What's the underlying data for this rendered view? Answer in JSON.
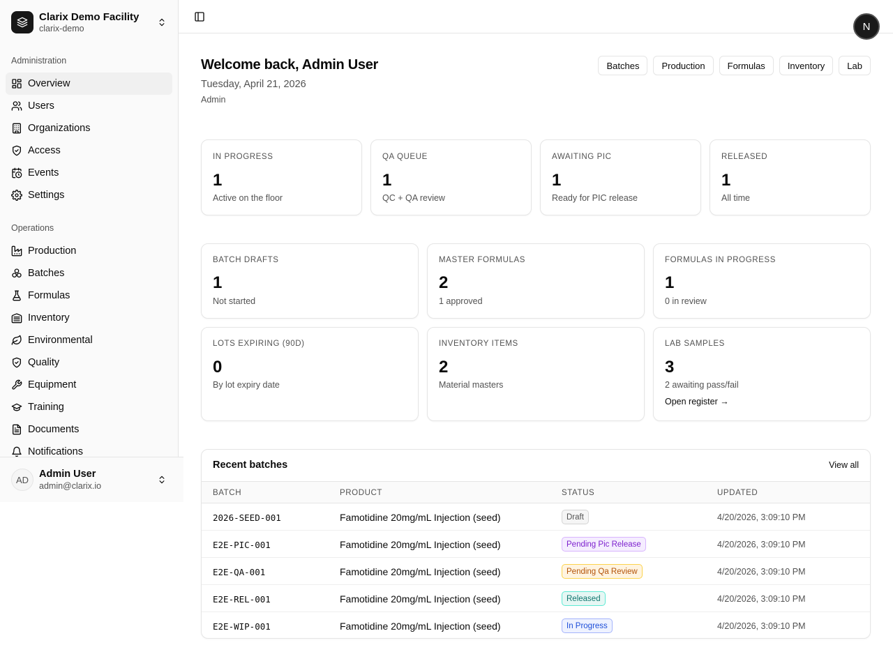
{
  "org": {
    "name": "Clarix Demo Facility",
    "slug": "clarix-demo"
  },
  "sidebar": {
    "groups": [
      {
        "label": "Administration",
        "items": [
          {
            "label": "Overview",
            "icon": "layout-dashboard-icon",
            "active": true
          },
          {
            "label": "Users",
            "icon": "users-icon"
          },
          {
            "label": "Organizations",
            "icon": "building-icon"
          },
          {
            "label": "Access",
            "icon": "shield-check-icon"
          },
          {
            "label": "Events",
            "icon": "calendar-clock-icon"
          },
          {
            "label": "Settings",
            "icon": "gear-icon"
          }
        ]
      },
      {
        "label": "Operations",
        "items": [
          {
            "label": "Production",
            "icon": "factory-icon"
          },
          {
            "label": "Batches",
            "icon": "boxes-icon"
          },
          {
            "label": "Formulas",
            "icon": "flask-icon"
          },
          {
            "label": "Inventory",
            "icon": "warehouse-icon"
          },
          {
            "label": "Environmental",
            "icon": "leaf-icon"
          },
          {
            "label": "Quality",
            "icon": "shield-icon"
          },
          {
            "label": "Equipment",
            "icon": "wrench-icon"
          },
          {
            "label": "Training",
            "icon": "graduation-cap-icon"
          },
          {
            "label": "Documents",
            "icon": "file-text-icon"
          },
          {
            "label": "Notifications",
            "icon": "bell-icon"
          }
        ]
      }
    ]
  },
  "user": {
    "initials": "AD",
    "name": "Admin User",
    "email": "admin@clarix.io"
  },
  "header": {
    "avatar_letter": "N"
  },
  "welcome": {
    "title": "Welcome back, Admin User",
    "date": "Tuesday, April 21, 2026",
    "role": "Admin"
  },
  "quick_links": [
    "Batches",
    "Production",
    "Formulas",
    "Inventory",
    "Lab"
  ],
  "stats_row1": [
    {
      "label": "IN PROGRESS",
      "value": "1",
      "sub": "Active on the floor"
    },
    {
      "label": "QA QUEUE",
      "value": "1",
      "sub": "QC + QA review"
    },
    {
      "label": "AWAITING PIC",
      "value": "1",
      "sub": "Ready for PIC release"
    },
    {
      "label": "RELEASED",
      "value": "1",
      "sub": "All time"
    }
  ],
  "stats_row2": [
    {
      "label": "BATCH DRAFTS",
      "value": "1",
      "sub": "Not started"
    },
    {
      "label": "MASTER FORMULAS",
      "value": "2",
      "sub": "1 approved"
    },
    {
      "label": "FORMULAS IN PROGRESS",
      "value": "1",
      "sub": "0 in review"
    }
  ],
  "stats_row3": [
    {
      "label": "LOTS EXPIRING (90D)",
      "value": "0",
      "sub": "By lot expiry date"
    },
    {
      "label": "INVENTORY ITEMS",
      "value": "2",
      "sub": "Material masters"
    },
    {
      "label": "LAB SAMPLES",
      "value": "3",
      "sub": "2 awaiting pass/fail",
      "link": "Open register →"
    }
  ],
  "recent": {
    "title": "Recent batches",
    "view_all": "View all",
    "columns": [
      "BATCH",
      "PRODUCT",
      "STATUS",
      "UPDATED"
    ],
    "rows": [
      {
        "batch": "2026-SEED-001",
        "product": "Famotidine 20mg/mL Injection (seed)",
        "status": "Draft",
        "status_tone": "neutral",
        "updated": "4/20/2026, 3:09:10 PM"
      },
      {
        "batch": "E2E-PIC-001",
        "product": "Famotidine 20mg/mL Injection (seed)",
        "status": "Pending Pic Release",
        "status_tone": "purple",
        "updated": "4/20/2026, 3:09:10 PM"
      },
      {
        "batch": "E2E-QA-001",
        "product": "Famotidine 20mg/mL Injection (seed)",
        "status": "Pending Qa Review",
        "status_tone": "amber",
        "updated": "4/20/2026, 3:09:10 PM"
      },
      {
        "batch": "E2E-REL-001",
        "product": "Famotidine 20mg/mL Injection (seed)",
        "status": "Released",
        "status_tone": "teal",
        "updated": "4/20/2026, 3:09:10 PM"
      },
      {
        "batch": "E2E-WIP-001",
        "product": "Famotidine 20mg/mL Injection (seed)",
        "status": "In Progress",
        "status_tone": "blue",
        "updated": "4/20/2026, 3:09:10 PM"
      }
    ]
  },
  "colors": {
    "sidebar_bg": "#fafafa",
    "border": "#e5e5e5",
    "text": "#0a0a0a",
    "muted": "#525252",
    "neutral_badge": "#f5f5f5",
    "purple_badge": "#f5edff",
    "amber_badge": "#fff4e0",
    "teal_badge": "#e6f7f4",
    "blue_badge": "#eef2ff"
  }
}
